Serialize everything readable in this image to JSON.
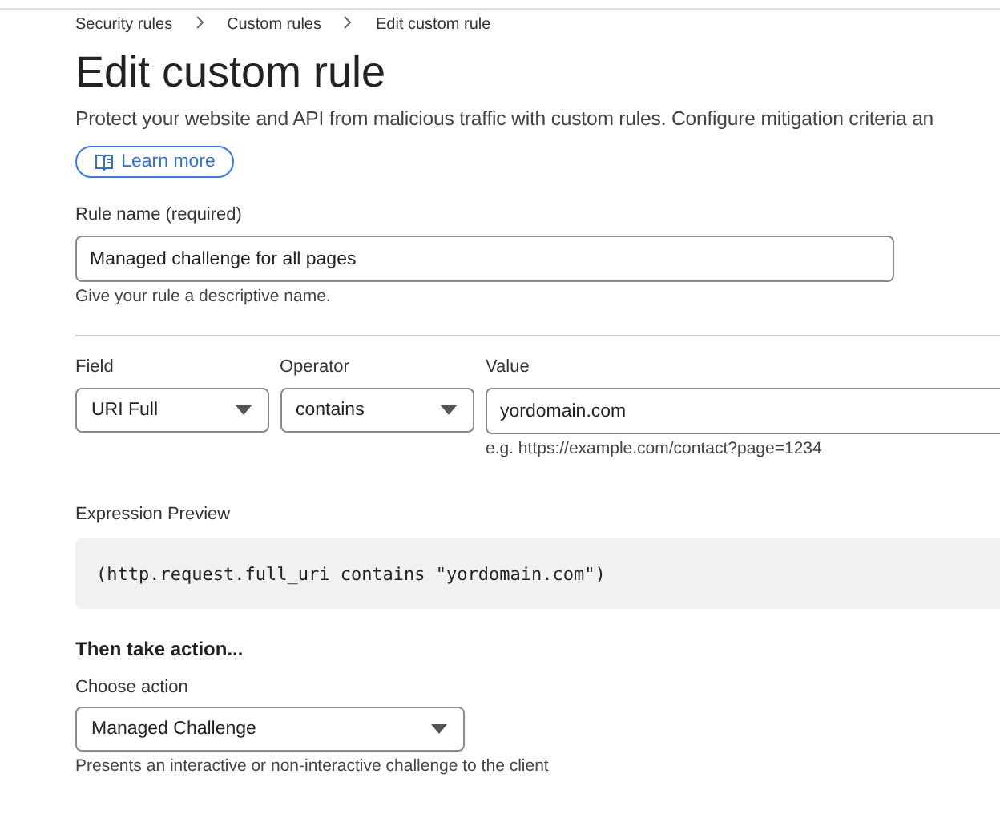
{
  "breadcrumbs": [
    "Security rules",
    "Custom rules",
    "Edit custom rule"
  ],
  "title": "Edit custom rule",
  "description": "Protect your website and API from malicious traffic with custom rules. Configure mitigation criteria an",
  "learn_more": {
    "label": "Learn more"
  },
  "rule_name": {
    "label": "Rule name (required)",
    "value": "Managed challenge for all pages",
    "hint": "Give your rule a descriptive name."
  },
  "expression": {
    "field": {
      "label": "Field",
      "value": "URI Full"
    },
    "operator": {
      "label": "Operator",
      "value": "contains"
    },
    "value": {
      "label": "Value",
      "value": "yordomain.com",
      "hint": "e.g. https://example.com/contact?page=1234"
    }
  },
  "preview": {
    "label": "Expression Preview",
    "code": "(http.request.full_uri contains \"yordomain.com\")"
  },
  "action": {
    "heading": "Then take action...",
    "label": "Choose action",
    "value": "Managed Challenge",
    "hint": "Presents an interactive or non-interactive challenge to the client"
  }
}
